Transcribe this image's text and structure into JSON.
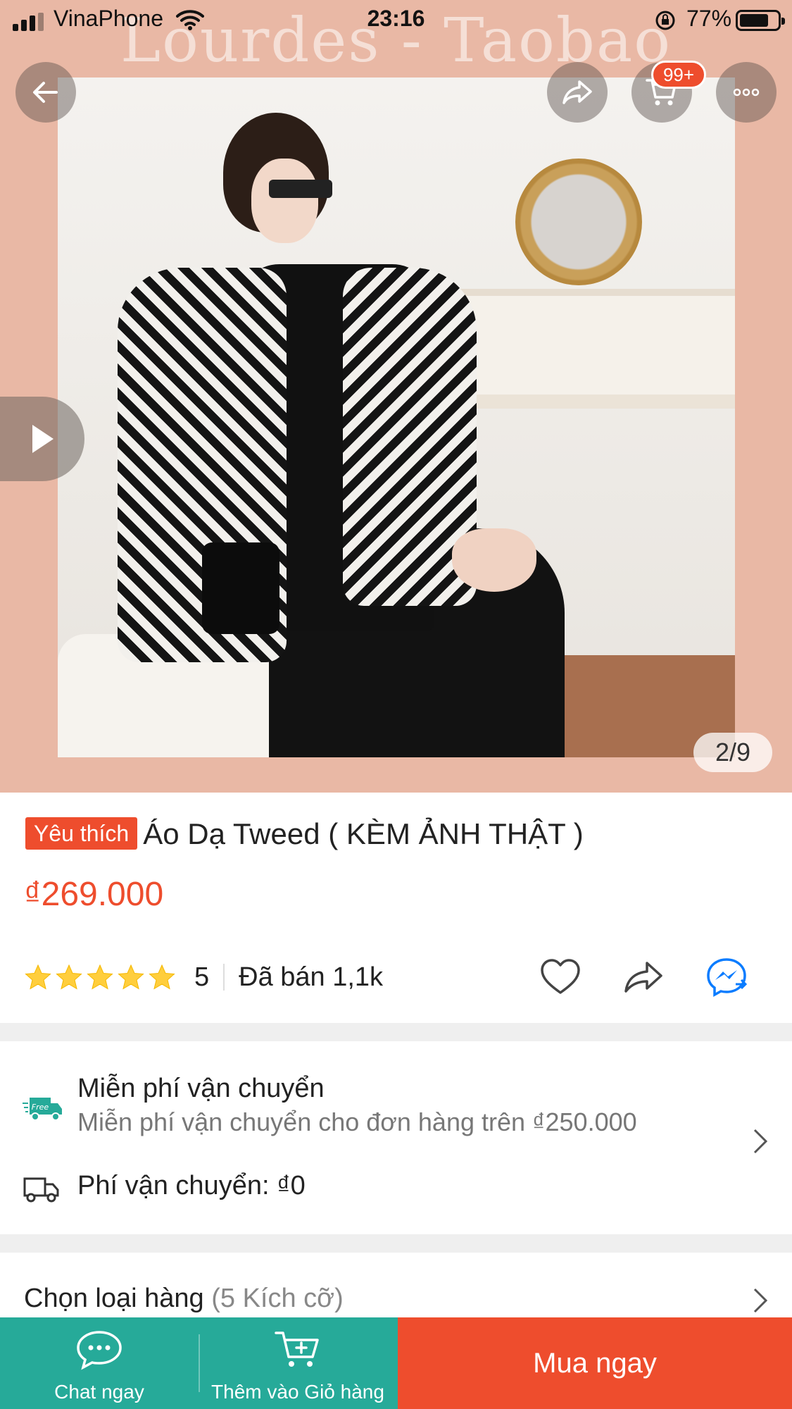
{
  "status_bar": {
    "carrier": "VinaPhone",
    "time": "23:16",
    "battery_percent": "77%"
  },
  "hero": {
    "watermark": "Lourdes - Taobao",
    "cart_badge": "99+",
    "image_counter": "2/9"
  },
  "product": {
    "badge": "Yêu thích",
    "title": "Áo Dạ Tweed ( KÈM ẢNH THẬT )",
    "price": "₫269.000",
    "rating": "5",
    "stars": 5,
    "sold": "Đã bán 1,1k"
  },
  "shipping": {
    "free_icon_text": "Free",
    "title": "Miễn phí vận chuyển",
    "subtitle": "Miễn phí vận chuyển cho đơn hàng trên ₫250.000",
    "fee": "Phí vận chuyển: ₫0"
  },
  "variant": {
    "label": "Chọn loại hàng",
    "count": "(5 Kích cỡ)"
  },
  "bottom_bar": {
    "chat_label": "Chat ngay",
    "add_cart_label": "Thêm vào Giỏ hàng",
    "buy_label": "Mua ngay"
  },
  "colors": {
    "accent": "#ee4d2d",
    "teal": "#26aa99",
    "messenger": "#0a7cff"
  }
}
